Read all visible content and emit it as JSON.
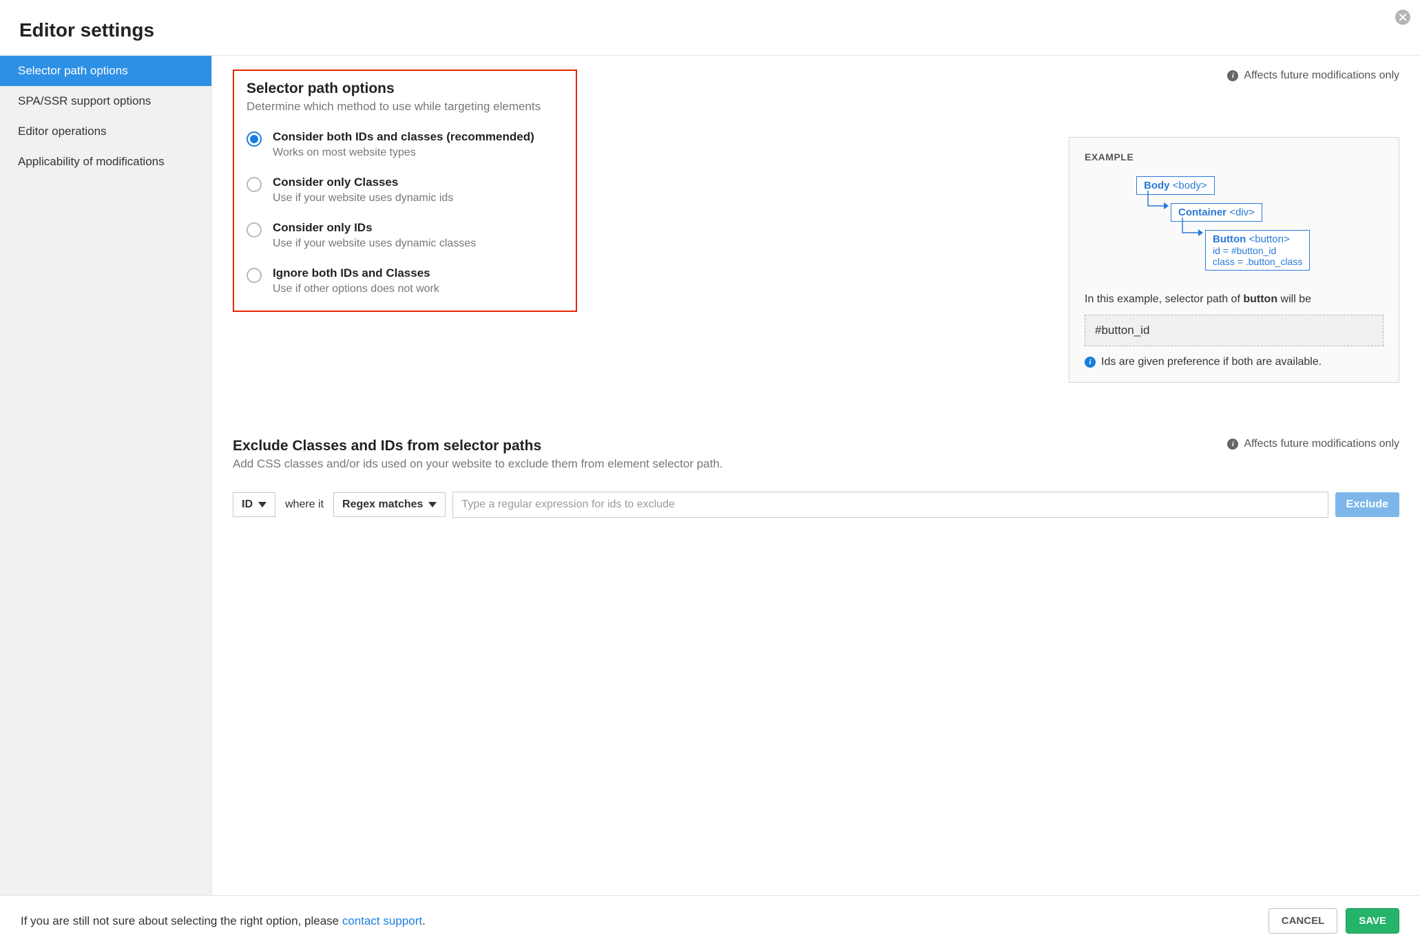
{
  "header": {
    "title": "Editor settings"
  },
  "sidebar": {
    "items": [
      {
        "label": "Selector path options",
        "active": true
      },
      {
        "label": "SPA/SSR support options",
        "active": false
      },
      {
        "label": "Editor operations",
        "active": false
      },
      {
        "label": "Applicability of modifications",
        "active": false
      }
    ]
  },
  "section1": {
    "title": "Selector path options",
    "desc": "Determine which method to use while targeting elements",
    "info_note": "Affects future modifications only",
    "options": [
      {
        "label": "Consider both IDs and classes (recommended)",
        "sub": "Works on most website types",
        "checked": true
      },
      {
        "label": "Consider only Classes",
        "sub": "Use if your website uses dynamic ids",
        "checked": false
      },
      {
        "label": "Consider only IDs",
        "sub": "Use if your website uses dynamic classes",
        "checked": false
      },
      {
        "label": "Ignore both IDs and Classes",
        "sub": "Use if other options does not work",
        "checked": false
      }
    ]
  },
  "example": {
    "heading": "EXAMPLE",
    "nodes": {
      "n1": {
        "label": "Body",
        "tag": "<body>"
      },
      "n2": {
        "label": "Container",
        "tag": "<div>"
      },
      "n3": {
        "label": "Button",
        "tag": "<button>",
        "line1": "id = #button_id",
        "line2": "class = .button_class"
      }
    },
    "desc_prefix": "In this example, selector path of ",
    "desc_bold": "button",
    "desc_suffix": " will be",
    "code": "#button_id",
    "note": "Ids are given preference if both are available."
  },
  "section2": {
    "title": "Exclude Classes and IDs from selector paths",
    "desc": "Add CSS classes and/or ids used on your website to exclude them from element selector path.",
    "info_note": "Affects future modifications only",
    "select1": "ID",
    "label_where": "where it",
    "select2": "Regex matches",
    "placeholder": "Type a regular expression for ids to exclude",
    "exclude_btn": "Exclude"
  },
  "footer": {
    "text_prefix": "If you are still not sure about selecting the right option, please ",
    "link_text": "contact support",
    "text_suffix": ".",
    "cancel": "CANCEL",
    "save": "SAVE"
  }
}
